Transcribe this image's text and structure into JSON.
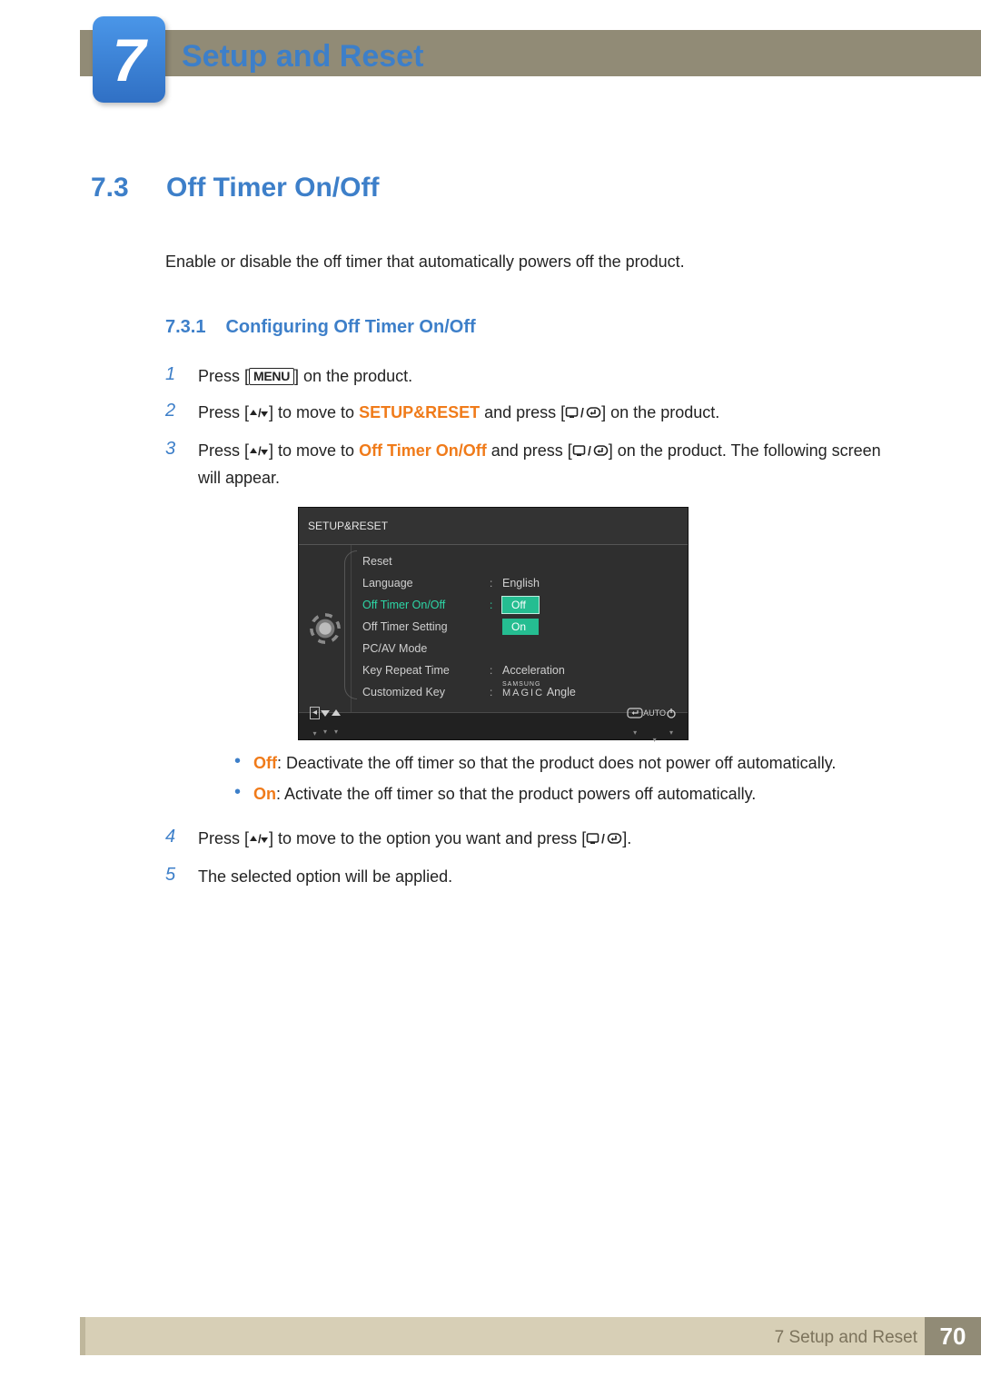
{
  "chapter": {
    "number": "7",
    "title": "Setup and Reset"
  },
  "section": {
    "number": "7.3",
    "title": "Off Timer On/Off",
    "intro": "Enable or disable the off timer that automatically powers off the product."
  },
  "subsection": {
    "number": "7.3.1",
    "title": "Configuring Off Timer On/Off"
  },
  "steps": {
    "s1_a": "Press [",
    "menu_label": "MENU",
    "s1_b": "] on the product.",
    "s2_a": "Press [",
    "s2_b": "] to move to ",
    "s2_hl": "SETUP&RESET",
    "s2_c": " and press [",
    "s2_d": "] on the product.",
    "s3_a": "Press [",
    "s3_b": "] to move to ",
    "s3_hl": "Off Timer On/Off",
    "s3_c": " and press [",
    "s3_d": "] on the product. The following screen will appear.",
    "opt_off_label": "Off",
    "opt_off_text": ": Deactivate the off timer so that the product does not power off automatically.",
    "opt_on_label": "On",
    "opt_on_text": ": Activate the off timer so that the product powers off automatically.",
    "s4_a": "Press [",
    "s4_b": "] to move to the option you want and press [",
    "s4_c": "].",
    "s5": "The selected option will be applied.",
    "num1": "1",
    "num2": "2",
    "num3": "3",
    "num4": "4",
    "num5": "5"
  },
  "osd": {
    "title": "SETUP&RESET",
    "items": {
      "reset": "Reset",
      "language": "Language",
      "language_val": "English",
      "offtimer": "Off Timer On/Off",
      "off": "Off",
      "on": "On",
      "offtimer_setting": "Off Timer Setting",
      "pcav": "PC/AV Mode",
      "keyrepeat": "Key Repeat Time",
      "keyrepeat_val": "Acceleration",
      "custkey": "Customized Key",
      "custkey_val_brand": "SAMSUNG",
      "custkey_val_magic": "MAGIC",
      "custkey_val_suffix": " Angle"
    },
    "footer": {
      "auto": "AUTO"
    }
  },
  "footer": {
    "label": "7 Setup and Reset",
    "page": "70"
  }
}
